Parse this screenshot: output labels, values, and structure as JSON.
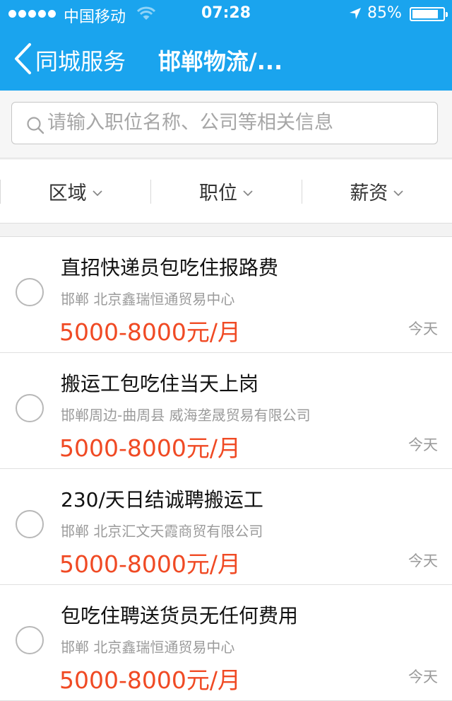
{
  "status_bar": {
    "carrier": "中国移动",
    "time": "07:28",
    "battery_percent_label": "85%",
    "battery_level": 0.85
  },
  "nav": {
    "back_label": "同城服务",
    "title": "邯郸物流/..."
  },
  "search": {
    "placeholder": "请输入职位名称、公司等相关信息",
    "value": ""
  },
  "filters": [
    {
      "label": "区域"
    },
    {
      "label": "职位"
    },
    {
      "label": "薪资"
    }
  ],
  "jobs": [
    {
      "title": "直招快递员包吃住报路费",
      "company": "邯郸 北京鑫瑞恒通贸易中心",
      "salary": "5000-8000元/月",
      "date": "今天"
    },
    {
      "title": "搬运工包吃住当天上岗",
      "company": "邯郸周边-曲周县 威海垄晟贸易有限公司",
      "salary": "5000-8000元/月",
      "date": "今天"
    },
    {
      "title": "230/天日结诚聘搬运工",
      "company": "邯郸 北京汇文天霞商贸有限公司",
      "salary": "5000-8000元/月",
      "date": "今天"
    },
    {
      "title": "包吃住聘送货员无任何费用",
      "company": "邯郸 北京鑫瑞恒通贸易中心",
      "salary": "5000-8000元/月",
      "date": "今天"
    }
  ],
  "colors": {
    "accent": "#1aa4ee",
    "salary": "#f04a24"
  }
}
